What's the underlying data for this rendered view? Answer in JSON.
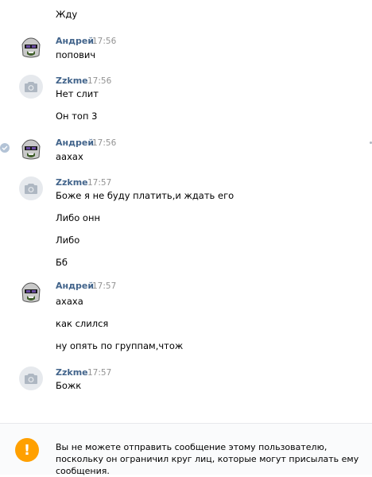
{
  "messages": {
    "m0": {
      "text": "Жду"
    },
    "g1": {
      "author": "Андрей",
      "time": "17:56",
      "lines": [
        "попович"
      ]
    },
    "g2": {
      "author": "Zzkme",
      "time": "17:56",
      "lines": [
        "Нет слит",
        "Он топ 3"
      ]
    },
    "g3": {
      "author": "Андрей",
      "time": "17:56",
      "lines": [
        "аахах"
      ]
    },
    "g4": {
      "author": "Zzkme",
      "time": "17:57",
      "lines": [
        "Боже я не буду платить,и ждать его",
        "Либо онн",
        "Либо",
        "Бб"
      ]
    },
    "g5": {
      "author": "Андрей",
      "time": "17:57",
      "lines": [
        "ахаха",
        "как слился",
        "ну опять по группам,чтож"
      ]
    },
    "g6": {
      "author": "Zzkme",
      "time": "17:57",
      "lines": [
        "Божк"
      ]
    }
  },
  "notice": {
    "text": "Вы не можете отправить сообщение этому пользователю, поскольку он ограничил круг лиц, которые могут присылать ему сообщения.",
    "icon": "!"
  },
  "colors": {
    "author": "#42648b",
    "time": "#939393",
    "warning": "#ffa000"
  },
  "icons": {
    "avatar_default": "camera-icon",
    "read": "checkmark-icon",
    "warning": "exclamation-icon"
  }
}
